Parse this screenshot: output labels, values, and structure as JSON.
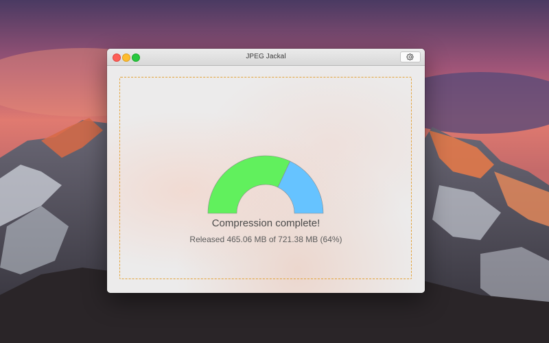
{
  "window": {
    "title": "JPEG Jackal",
    "settings_icon": "gear-icon"
  },
  "main": {
    "status_title": "Compression complete!",
    "status_detail": "Released 465.06 MB of 721.38 MB (64%)"
  },
  "gauge": {
    "released_fraction": 0.64,
    "colors": {
      "released": "#61f05d",
      "remaining": "#66c3ff"
    }
  },
  "colors": {
    "dropzone_border": "#e3a33a"
  }
}
